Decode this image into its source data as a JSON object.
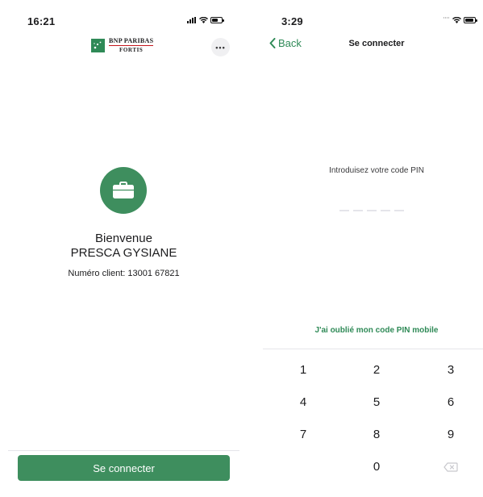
{
  "left": {
    "status": {
      "time": "16:21"
    },
    "logo": {
      "line1": "BNP PARIBAS",
      "line2": "FORTIS"
    },
    "more_label": "•••",
    "welcome": {
      "title": "Bienvenue",
      "name": "PRESCA GYSIANE",
      "client_number": "Numéro client: 13001 67821"
    },
    "login_button": "Se connecter"
  },
  "right": {
    "status": {
      "time": "3:29"
    },
    "nav": {
      "back_label": "Back",
      "title": "Se connecter"
    },
    "pin": {
      "prompt": "Introduisez votre code PIN",
      "forgot_label": "J'ai oublié mon code PIN mobile"
    },
    "keypad": {
      "keys": [
        "1",
        "2",
        "3",
        "4",
        "5",
        "6",
        "7",
        "8",
        "9",
        "0"
      ]
    }
  },
  "colors": {
    "brand_green": "#3e8e5e",
    "link_green": "#2f8a57",
    "divider": "#e5e5ea",
    "logo_red": "#c4161c"
  },
  "icons": [
    "signal-icon",
    "wifi-icon",
    "battery-icon",
    "briefcase-icon",
    "back-chevron-icon",
    "backspace-icon",
    "bnp-logo-icon"
  ]
}
